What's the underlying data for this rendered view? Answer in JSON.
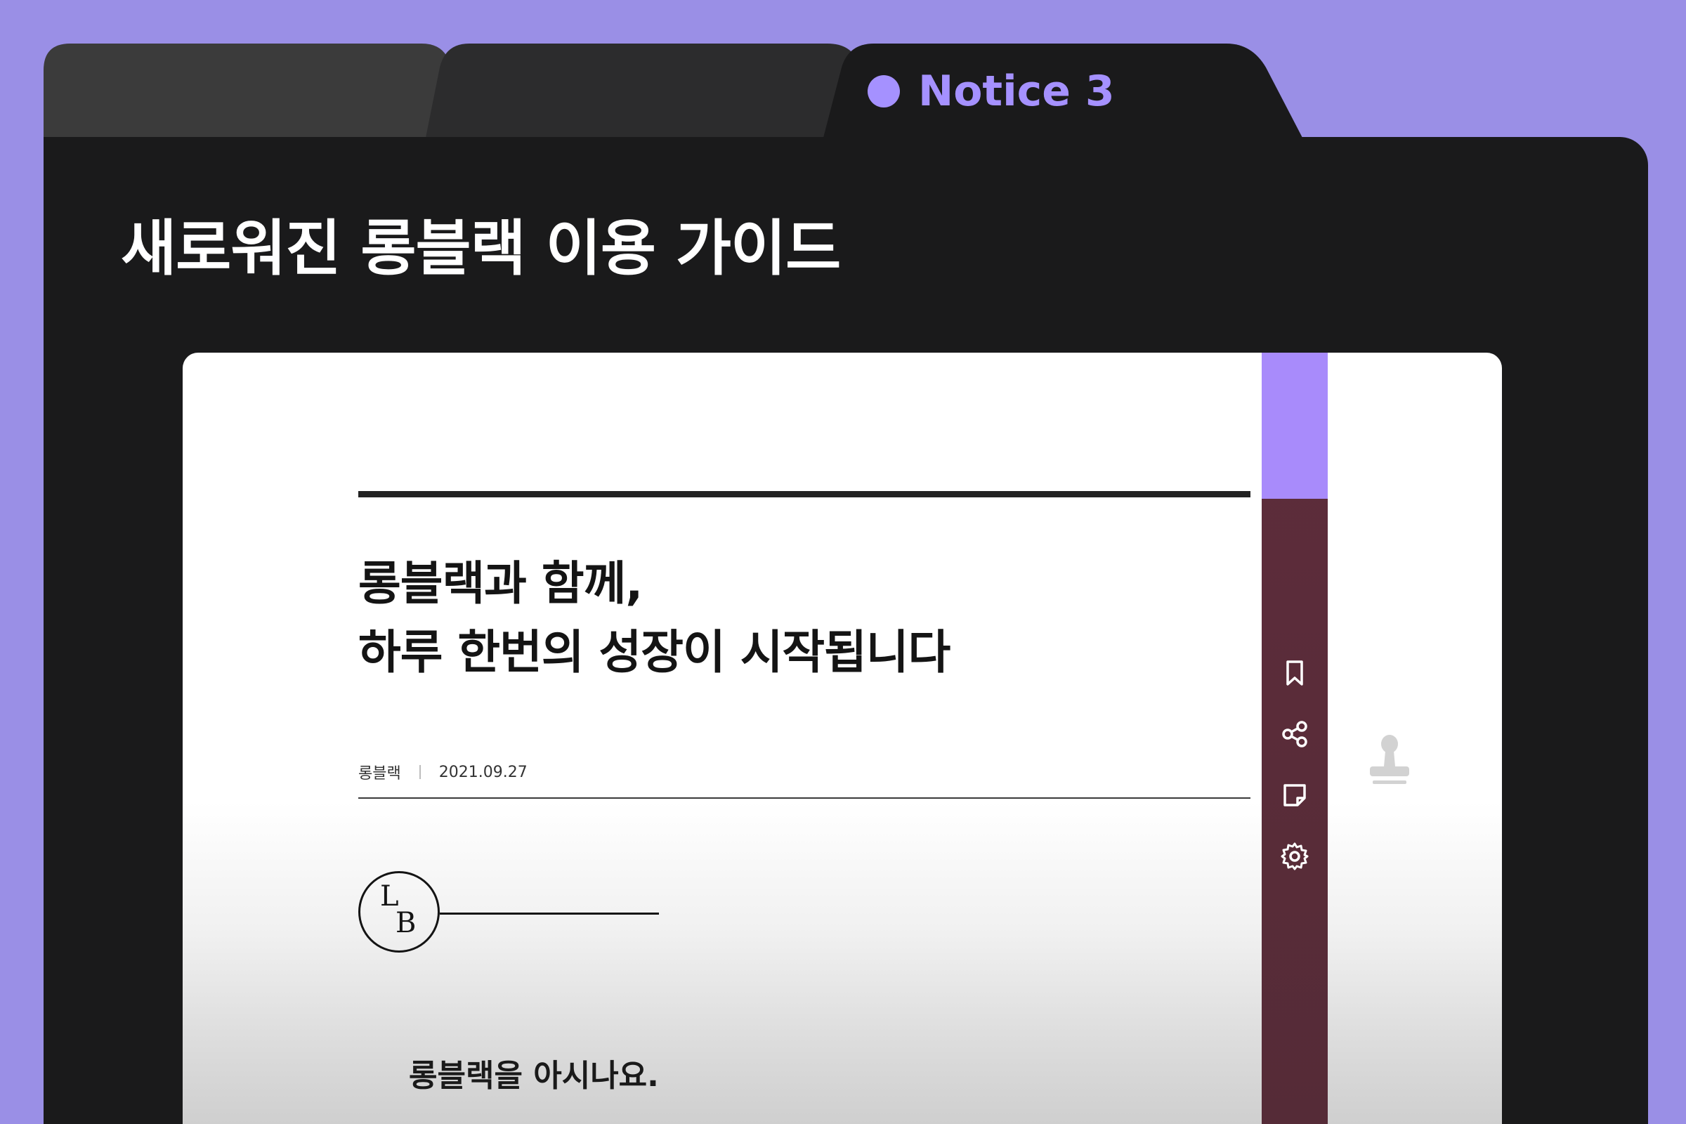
{
  "tabs": [
    {
      "label": ""
    },
    {
      "label": ""
    },
    {
      "label": "Notice 3",
      "active": true
    }
  ],
  "page": {
    "title": "새로워진 롱블랙 이용 가이드"
  },
  "article": {
    "headline_lines": [
      "롱블랙과 함께,",
      "하루 한번의 성장이 시작됩니다"
    ],
    "author": "롱블랙",
    "date": "2021.09.27",
    "logo": {
      "letter_top": "L",
      "letter_bottom": "B"
    },
    "intro": "롱블랙을 아시나요."
  },
  "toolbar": {
    "icons": [
      "bookmark-icon",
      "share-icon",
      "memo-icon",
      "gear-icon"
    ]
  },
  "colors": {
    "background": "#9a8fe6",
    "window": "#1a1a1b",
    "accent": "#a591ff",
    "sidebar": "#5e2d3b",
    "sidebar_accent": "#a88bfb"
  }
}
